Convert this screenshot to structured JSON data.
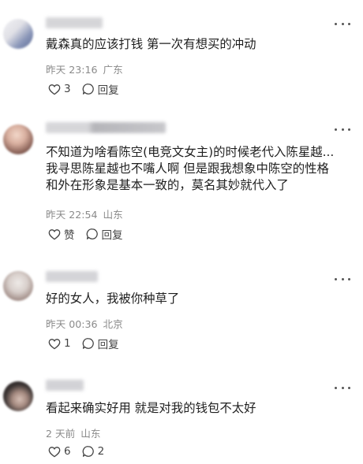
{
  "comments": [
    {
      "text_lines": [
        "戴森真的应该打钱 第一次有想买的冲动"
      ],
      "time": "昨天 23:16",
      "location": "广东",
      "like_label": "3",
      "reply_label": "回复",
      "avatar_colors": [
        "#e8e8ee",
        "#6f7ea8"
      ],
      "name_color": "#c8c8cc"
    },
    {
      "text_lines": [
        "不知道为啥看陈空(电竞文女主)的时候老代入陈星越...",
        "我寻思陈星越也不嘴人啊 但是跟我想象中陈空的性格",
        "和外在形象是基本一致的，莫名其妙就代入了"
      ],
      "time": "昨天 22:54",
      "location": "山东",
      "like_label": "赞",
      "reply_label": "回复",
      "avatar_colors": [
        "#d9b8a8",
        "#6a4c44"
      ],
      "name_color": "#b9b9be"
    },
    {
      "text_lines": [
        "好的女人，我被你种草了"
      ],
      "time": "昨天 00:36",
      "location": "北京",
      "like_label": "1",
      "reply_label": "回复",
      "avatar_colors": [
        "#ddd6d2",
        "#8e7c76"
      ],
      "name_color": "#c6c6cb"
    },
    {
      "text_lines": [
        "看起来确实好用 就是对我的钱包不太好"
      ],
      "time": "2 天前",
      "location": "山东",
      "like_label": "6",
      "reply_label": "2",
      "avatar_colors": [
        "#3b3433",
        "#c9b3a9"
      ],
      "name_color": "#c4c4c9"
    }
  ]
}
